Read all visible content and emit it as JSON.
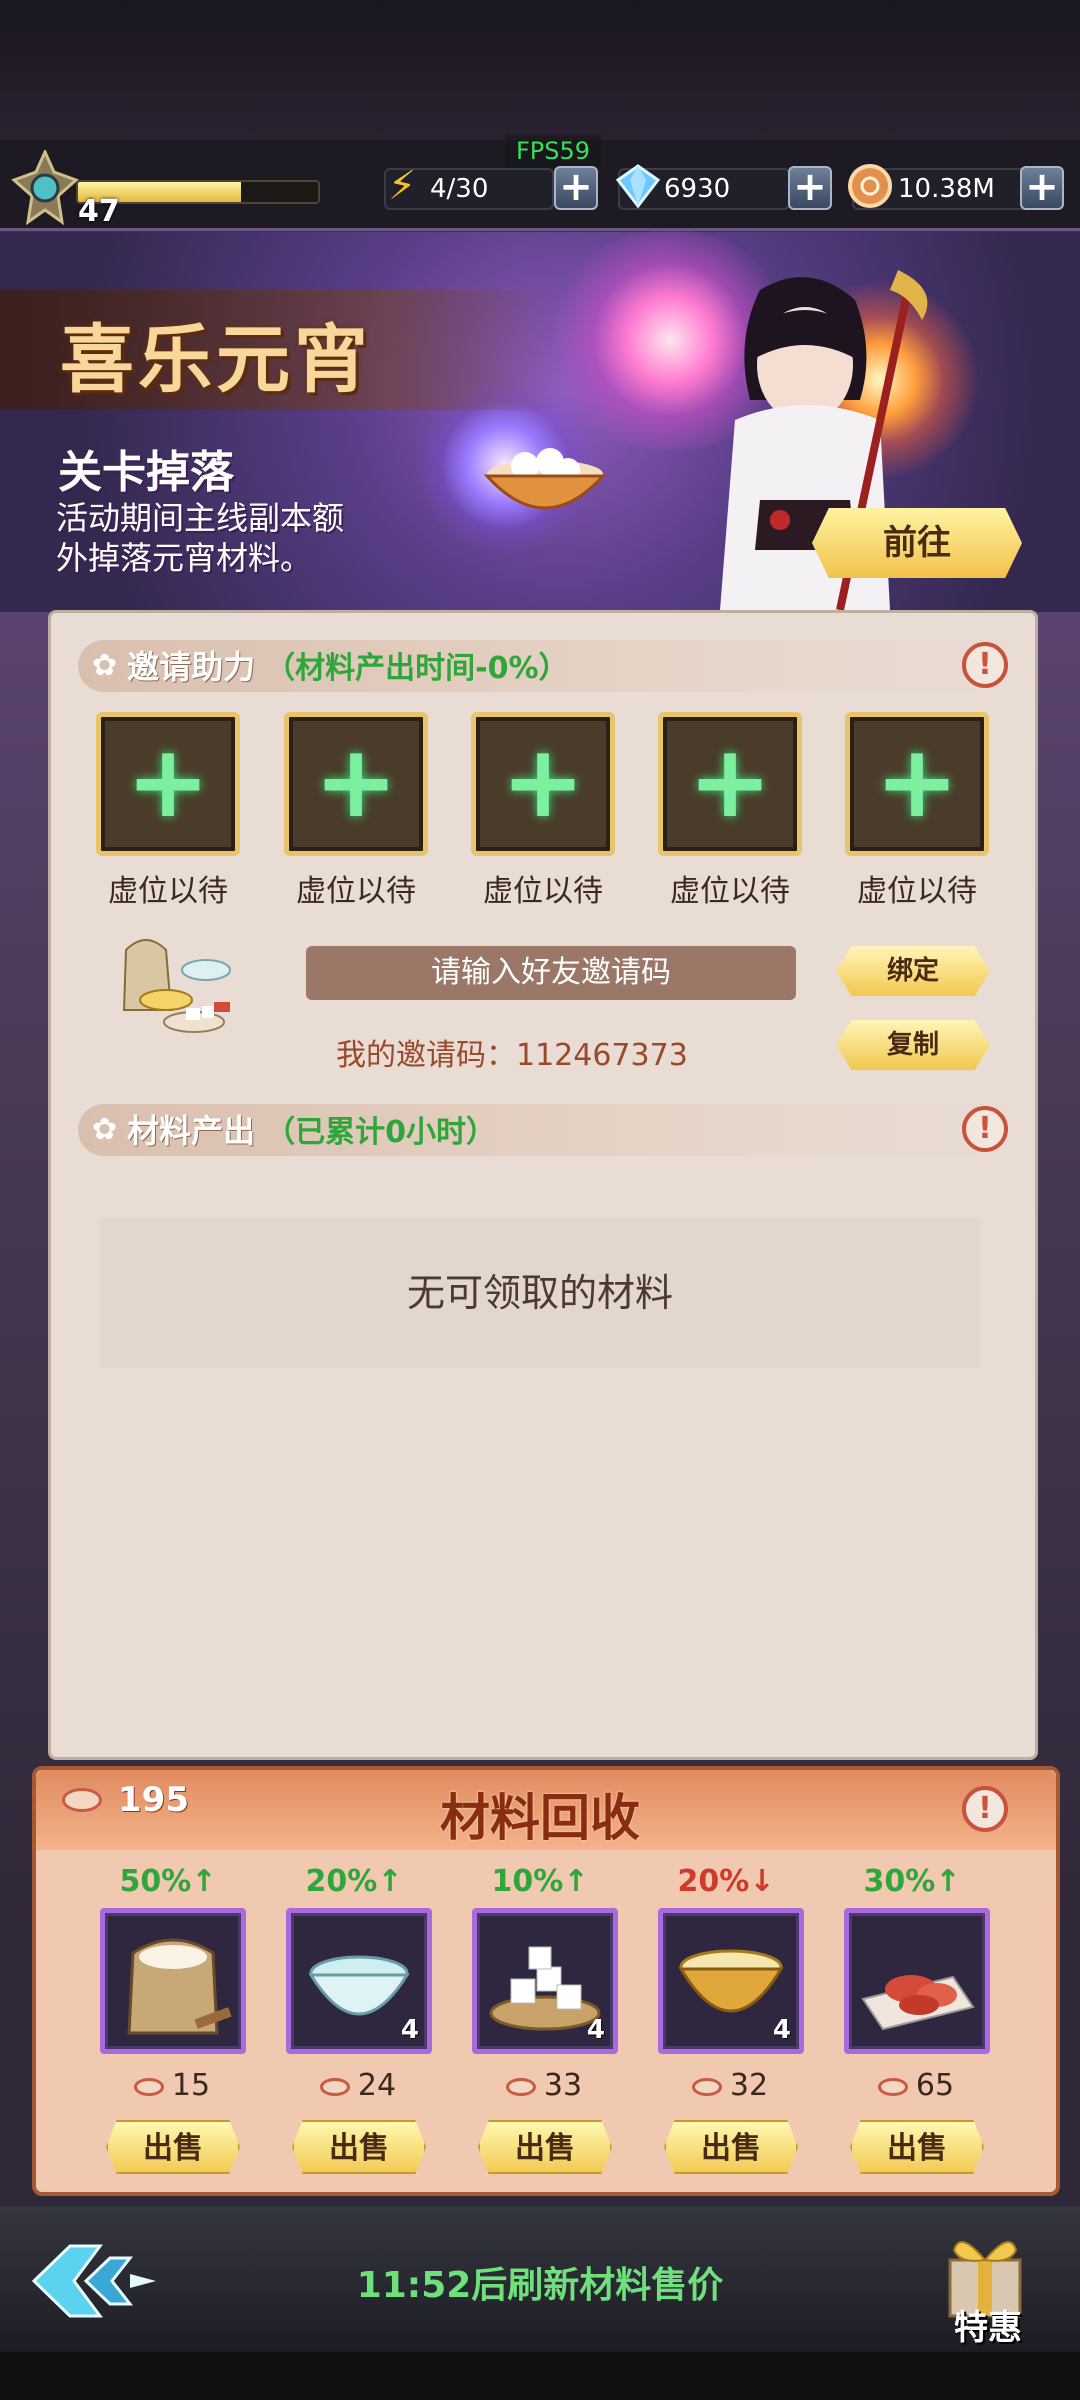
{
  "hud": {
    "fps": "FPS59",
    "level": "47",
    "xp_fraction": 0.68,
    "energy": "4/30",
    "gems": "6930",
    "coins": "10.38M"
  },
  "banner": {
    "title": "喜乐元宵",
    "subtitle": "关卡掉落",
    "desc_line1": "活动期间主线副本额",
    "desc_line2": "外掉落元宵材料。",
    "go_label": "前往"
  },
  "invite": {
    "section_title": "邀请助力",
    "section_note": "（材料产出时间-0%）",
    "slots": [
      {
        "label": "虚位以待"
      },
      {
        "label": "虚位以待"
      },
      {
        "label": "虚位以待"
      },
      {
        "label": "虚位以待"
      },
      {
        "label": "虚位以待"
      }
    ],
    "input_placeholder": "请输入好友邀请码",
    "bind_label": "绑定",
    "copy_label": "复制",
    "my_code": "我的邀请码：112467373"
  },
  "output": {
    "section_title": "材料产出",
    "section_note": "（已累计0小时）",
    "empty_text": "无可领取的材料"
  },
  "recycle": {
    "title": "材料回收",
    "total": "195",
    "items": [
      {
        "pct": "50%↑",
        "trend": "up",
        "count": "",
        "price": "15",
        "sell": "出售",
        "icon": "flour-sack-icon"
      },
      {
        "pct": "20%↑",
        "trend": "up",
        "count": "4",
        "price": "24",
        "sell": "出售",
        "icon": "water-bowl-icon"
      },
      {
        "pct": "10%↑",
        "trend": "up",
        "count": "4",
        "price": "33",
        "sell": "出售",
        "icon": "sugar-cubes-icon"
      },
      {
        "pct": "20%↓",
        "trend": "down",
        "count": "4",
        "price": "32",
        "sell": "出售",
        "icon": "golden-bowl-icon"
      },
      {
        "pct": "30%↑",
        "trend": "up",
        "count": "",
        "price": "65",
        "sell": "出售",
        "icon": "red-filling-icon"
      }
    ]
  },
  "footer": {
    "refresh_text": "11:52后刷新材料售价",
    "gift_label": "特惠"
  },
  "colors": {
    "up": "#2ea63a",
    "down": "#d03a2a"
  }
}
